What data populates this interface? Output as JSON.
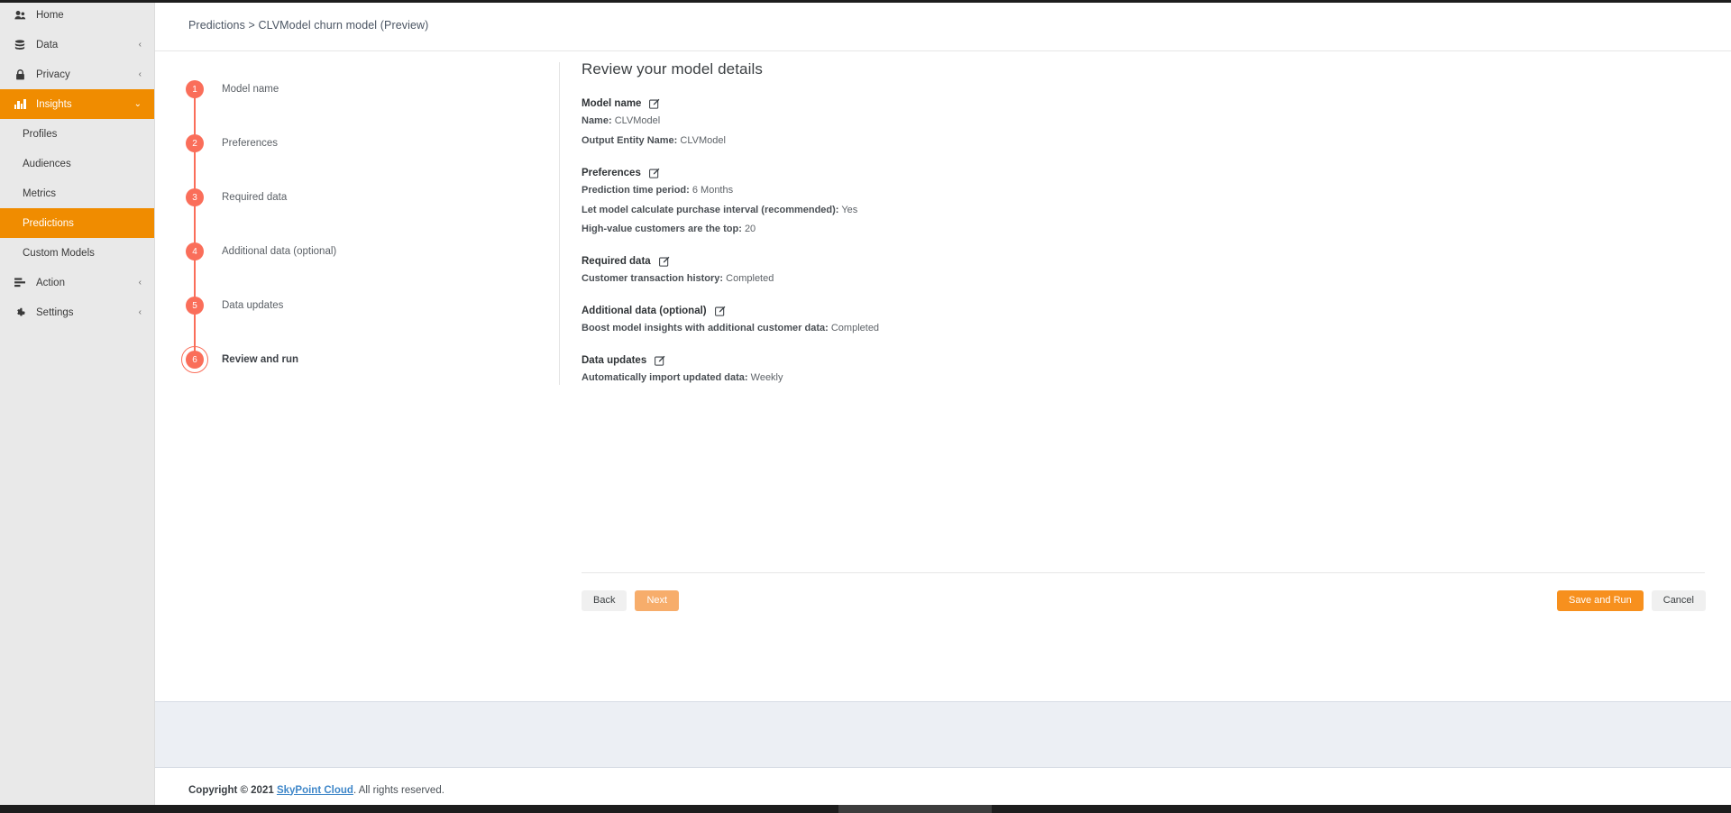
{
  "sidebar": {
    "items": [
      {
        "label": "Home",
        "icon": "home-icon",
        "glyph": "❖",
        "chevron": "",
        "active": false,
        "type": "item"
      },
      {
        "label": "Data",
        "icon": "database-icon",
        "glyph": "☰",
        "chevron": "‹",
        "active": false,
        "type": "item"
      },
      {
        "label": "Privacy",
        "icon": "lock-icon",
        "glyph": "ὑ2",
        "chevron": "‹",
        "active": false,
        "type": "item"
      },
      {
        "label": "Insights",
        "icon": "bar-chart-icon",
        "glyph": "",
        "chevron": "⌄",
        "active": true,
        "type": "item"
      },
      {
        "label": "Profiles",
        "icon": "",
        "glyph": "",
        "chevron": "",
        "active": false,
        "type": "sub"
      },
      {
        "label": "Audiences",
        "icon": "",
        "glyph": "",
        "chevron": "",
        "active": false,
        "type": "sub"
      },
      {
        "label": "Metrics",
        "icon": "",
        "glyph": "",
        "chevron": "",
        "active": false,
        "type": "sub"
      },
      {
        "label": "Predictions",
        "icon": "",
        "glyph": "",
        "chevron": "",
        "active": true,
        "type": "sub"
      },
      {
        "label": "Custom Models",
        "icon": "",
        "glyph": "",
        "chevron": "",
        "active": false,
        "type": "sub"
      },
      {
        "label": "Action",
        "icon": "action-icon",
        "glyph": "≡",
        "chevron": "‹",
        "active": false,
        "type": "item"
      },
      {
        "label": "Settings",
        "icon": "gear-icon",
        "glyph": "⚙",
        "chevron": "‹",
        "active": false,
        "type": "item"
      }
    ]
  },
  "breadcrumb": {
    "text": "Predictions > CLVModel churn model (Preview)",
    "root": "Predictions",
    "separator": ">",
    "current": "CLVModel churn model (Preview)"
  },
  "stepper": {
    "steps": [
      {
        "number": "1",
        "label": "Model name",
        "current": false
      },
      {
        "number": "2",
        "label": "Preferences",
        "current": false
      },
      {
        "number": "3",
        "label": "Required data",
        "current": false
      },
      {
        "number": "4",
        "label": "Additional data (optional)",
        "current": false
      },
      {
        "number": "5",
        "label": "Data updates",
        "current": false
      },
      {
        "number": "6",
        "label": "Review and run",
        "current": true
      }
    ]
  },
  "details": {
    "title": "Review your model details",
    "edit_icon": "edit-pencil-icon",
    "sections": [
      {
        "heading": "Model name",
        "rows": [
          {
            "key": "Name:",
            "value": "CLVModel"
          },
          {
            "key": "Output Entity Name:",
            "value": "CLVModel"
          }
        ]
      },
      {
        "heading": "Preferences",
        "rows": [
          {
            "key": "Prediction time period:",
            "value": "6 Months"
          },
          {
            "key": "Let model calculate purchase interval (recommended):",
            "value": "Yes"
          },
          {
            "key": "High-value customers are the top:",
            "value": "20"
          }
        ]
      },
      {
        "heading": "Required data",
        "rows": [
          {
            "key": "Customer transaction history:",
            "value": "Completed"
          }
        ]
      },
      {
        "heading": "Additional data (optional)",
        "rows": [
          {
            "key": "Boost model insights with additional customer data:",
            "value": "Completed"
          }
        ]
      },
      {
        "heading": "Data updates",
        "rows": [
          {
            "key": "Automatically import updated data:",
            "value": "Weekly"
          }
        ]
      }
    ]
  },
  "actions": {
    "back_label": "Back",
    "next_label": "Next",
    "save_and_run_label": "Save and Run",
    "cancel_label": "Cancel"
  },
  "footer": {
    "copyright_prefix": "Copyright © 2021",
    "brand": "SkyPoint Cloud",
    "suffix": ". All rights reserved."
  },
  "colors": {
    "accent_orange": "#f08c00",
    "button_orange": "#f7901e",
    "button_orange_light": "#f7ad6b",
    "step_salmon": "#fa6e5a",
    "page_bg": "#eceff4",
    "sidebar_bg": "#e9e9e9",
    "link_blue": "#3f87c9"
  }
}
